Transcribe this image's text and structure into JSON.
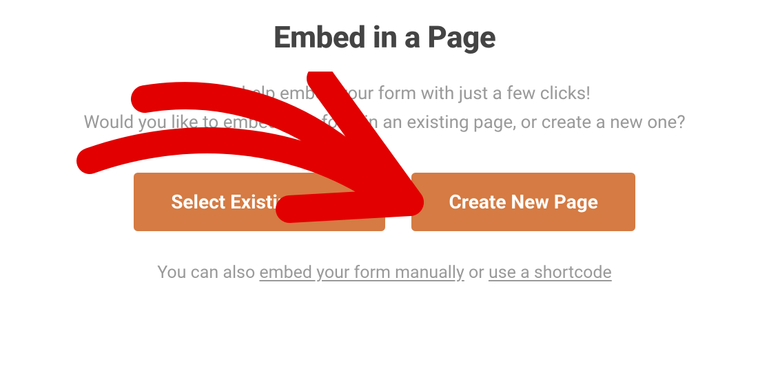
{
  "title": "Embed in a Page",
  "subtitle_line1": "We can help embed your form with just a few clicks!",
  "subtitle_line2": "Would you like to embed your form in an existing page, or create a new one?",
  "buttons": {
    "select_existing": "Select Existing Page",
    "create_new": "Create New Page"
  },
  "footer": {
    "prefix": "You can also ",
    "link1": "embed your form manually",
    "mid": " or ",
    "link2": "use a shortcode"
  },
  "annotation": {
    "color": "#e20000"
  }
}
